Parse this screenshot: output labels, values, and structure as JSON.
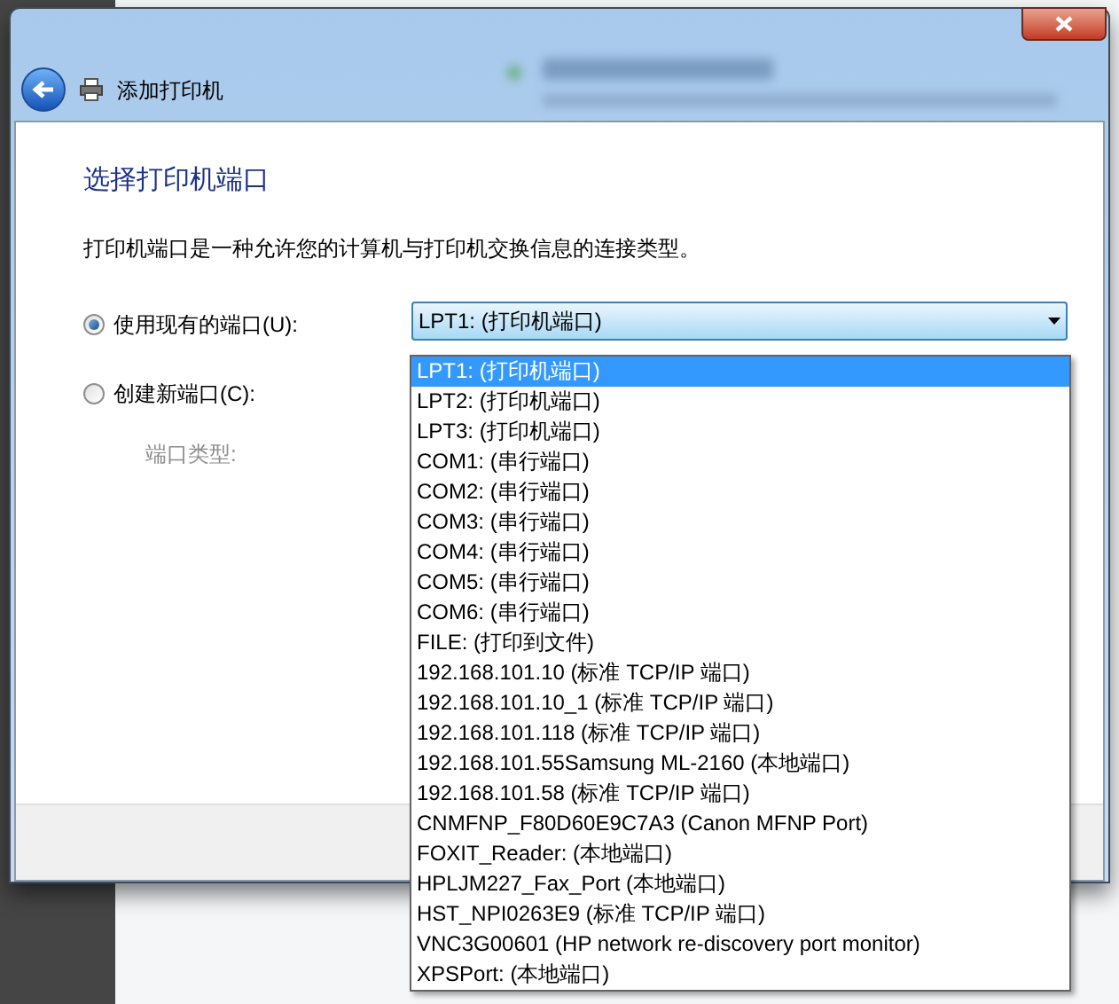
{
  "window": {
    "title": "添加打印机"
  },
  "heading": "选择打印机端口",
  "description": "打印机端口是一种允许您的计算机与打印机交换信息的连接类型。",
  "options": [
    {
      "label": "使用现有的端口(U):",
      "selected": true
    },
    {
      "label": "创建新端口(C):",
      "selected": false
    }
  ],
  "port_type": {
    "label": "端口类型:",
    "disabled": true
  },
  "port_dropdown": {
    "value": "LPT1: (打印机端口)",
    "expanded": true,
    "items": [
      {
        "label": "LPT1: (打印机端口)",
        "selected": true
      },
      {
        "label": "LPT2: (打印机端口)",
        "selected": false
      },
      {
        "label": "LPT3: (打印机端口)",
        "selected": false
      },
      {
        "label": "COM1: (串行端口)",
        "selected": false
      },
      {
        "label": "COM2: (串行端口)",
        "selected": false
      },
      {
        "label": "COM3: (串行端口)",
        "selected": false
      },
      {
        "label": "COM4: (串行端口)",
        "selected": false
      },
      {
        "label": "COM5: (串行端口)",
        "selected": false
      },
      {
        "label": "COM6: (串行端口)",
        "selected": false
      },
      {
        "label": "FILE: (打印到文件)",
        "selected": false
      },
      {
        "label": "192.168.101.10 (标准 TCP/IP 端口)",
        "selected": false
      },
      {
        "label": "192.168.101.10_1 (标准 TCP/IP 端口)",
        "selected": false
      },
      {
        "label": "192.168.101.118 (标准 TCP/IP 端口)",
        "selected": false
      },
      {
        "label": "192.168.101.55Samsung ML-2160 (本地端口)",
        "selected": false
      },
      {
        "label": "192.168.101.58 (标准 TCP/IP 端口)",
        "selected": false
      },
      {
        "label": "CNMFNP_F80D60E9C7A3 (Canon MFNP Port)",
        "selected": false
      },
      {
        "label": "FOXIT_Reader: (本地端口)",
        "selected": false
      },
      {
        "label": "HPLJM227_Fax_Port (本地端口)",
        "selected": false
      },
      {
        "label": "HST_NPI0263E9 (标准 TCP/IP 端口)",
        "selected": false
      },
      {
        "label": "VNC3G00601 (HP network re-discovery port monitor)",
        "selected": false
      },
      {
        "label": "XPSPort: (本地端口)",
        "selected": false
      }
    ]
  }
}
